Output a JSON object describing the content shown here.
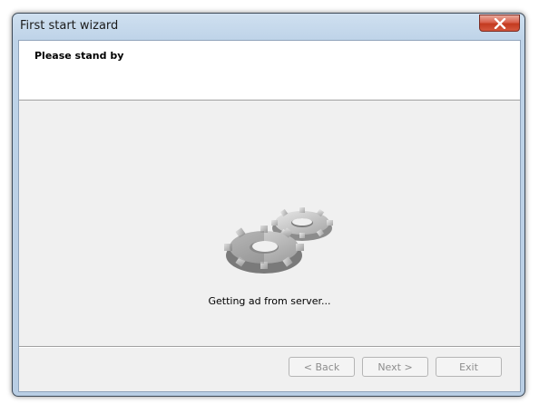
{
  "window": {
    "title": "First start wizard",
    "close_icon": "close-icon"
  },
  "header": {
    "title": "Please stand by"
  },
  "main": {
    "illustration_icon": "gears-icon",
    "status": "Getting ad from server..."
  },
  "footer": {
    "back_label": "< Back",
    "next_label": "Next >",
    "exit_label": "Exit",
    "buttons_enabled": false
  },
  "colors": {
    "close_button": "#d4573e",
    "client_background": "#f0f0f0"
  }
}
